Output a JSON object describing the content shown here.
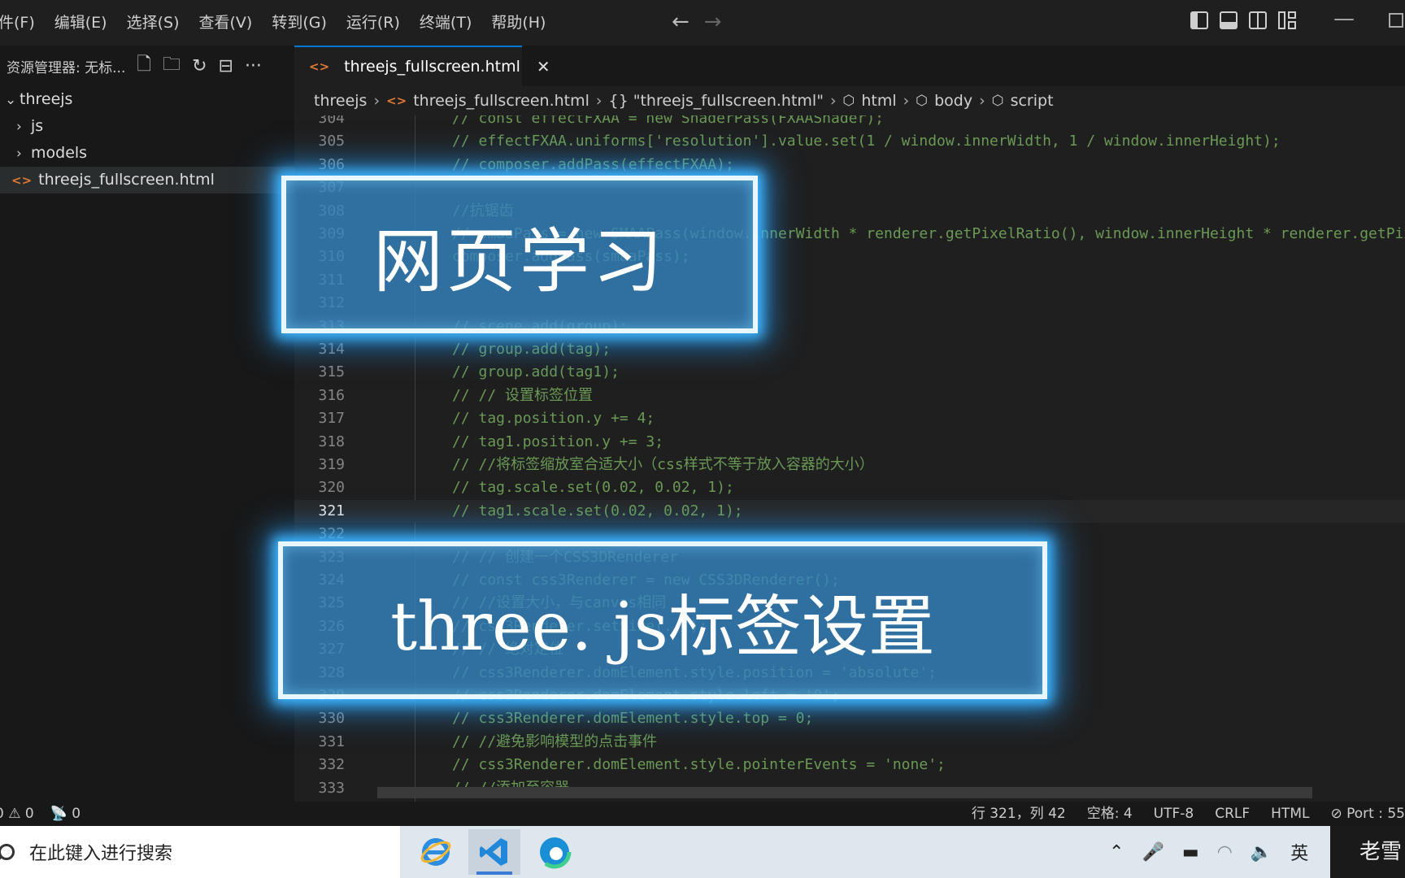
{
  "menubar": {
    "items": [
      "件(F)",
      "编辑(E)",
      "选择(S)",
      "查看(V)",
      "转到(G)",
      "运行(R)",
      "终端(T)",
      "帮助(H)"
    ],
    "back_icon": "arrow-left-icon",
    "forward_icon": "arrow-right-icon",
    "minimize": "—"
  },
  "sidebar": {
    "title": "资源管理器: 无标...",
    "more": "···",
    "root": "threejs",
    "folders": [
      "js",
      "models"
    ],
    "file": "threejs_fullscreen.html"
  },
  "tab": {
    "label": "threejs_fullscreen.html",
    "close": "✕"
  },
  "breadcrumb": {
    "folder": "threejs",
    "file": "threejs_fullscreen.html",
    "json_node": "{} \"threejs_fullscreen.html\"",
    "nodes": [
      "html",
      "body",
      "script"
    ]
  },
  "code_lines": [
    {
      "num": "304",
      "text": "// const effectFXAA = new ShaderPass(FXAAShader);"
    },
    {
      "num": "305",
      "text": "// effectFXAA.uniforms['resolution'].value.set(1 / window.innerWidth, 1 / window.innerHeight);"
    },
    {
      "num": "306",
      "text": "// composer.addPass(effectFXAA);"
    },
    {
      "num": "307",
      "text": ""
    },
    {
      "num": "308",
      "text": "//抗锯齿"
    },
    {
      "num": "309",
      "text": "// smaaPass = new SMAAPass(window.innerWidth * renderer.getPixelRatio(), window.innerHeight * renderer.getPixelRatio());"
    },
    {
      "num": "310",
      "text": "composer.addPass(smaaPass);"
    },
    {
      "num": "311",
      "text": ""
    },
    {
      "num": "312",
      "text": ""
    },
    {
      "num": "313",
      "text": "// scene.add(group);"
    },
    {
      "num": "314",
      "text": "// group.add(tag);"
    },
    {
      "num": "315",
      "text": "// group.add(tag1);"
    },
    {
      "num": "316",
      "text": "// // 设置标签位置"
    },
    {
      "num": "317",
      "text": "// tag.position.y += 4;"
    },
    {
      "num": "318",
      "text": "// tag1.position.y += 3;"
    },
    {
      "num": "319",
      "text": "// //将标签缩放室合适大小（css样式不等于放入容器的大小）"
    },
    {
      "num": "320",
      "text": "// tag.scale.set(0.02, 0.02, 1);"
    },
    {
      "num": "321",
      "text": "// tag1.scale.set(0.02, 0.02, 1);"
    },
    {
      "num": "322",
      "text": ""
    },
    {
      "num": "323",
      "text": "// // 创建一个CSS3DRenderer"
    },
    {
      "num": "324",
      "text": "// const css3Renderer = new CSS3DRenderer();"
    },
    {
      "num": "325",
      "text": "// //设置大小，与canvas相同"
    },
    {
      "num": "326",
      "text": "// css3Renderer.setSize(...);"
    },
    {
      "num": "327",
      "text": "// // 绝对定位"
    },
    {
      "num": "328",
      "text": "// css3Renderer.domElement.style.position = 'absolute';"
    },
    {
      "num": "329",
      "text": "// css3Renderer.domElement.style.left = '0';"
    },
    {
      "num": "330",
      "text": "// css3Renderer.domElement.style.top = 0;"
    },
    {
      "num": "331",
      "text": "// //避免影响模型的点击事件"
    },
    {
      "num": "332",
      "text": "// css3Renderer.domElement.style.pointerEvents = 'none';"
    },
    {
      "num": "333",
      "text": "// //添加至容器"
    }
  ],
  "active_line": "321",
  "statusbar": {
    "errors": "0",
    "warnings": "0",
    "ports": "0",
    "position": "行 321，列 42",
    "spaces": "空格: 4",
    "encoding": "UTF-8",
    "eol": "CRLF",
    "language": "HTML",
    "port": "Port : 55"
  },
  "taskbar": {
    "search_placeholder": "在此键入进行搜索",
    "ime": "英",
    "corner_text": "老雪"
  },
  "overlay": {
    "title_1": "网页学习",
    "title_2": "three. js标签设置"
  },
  "colors": {
    "accent": "#0078d4",
    "comment": "#6a9955",
    "overlay_fill": "#3482be",
    "overlay_glow": "#3fb6ff"
  }
}
